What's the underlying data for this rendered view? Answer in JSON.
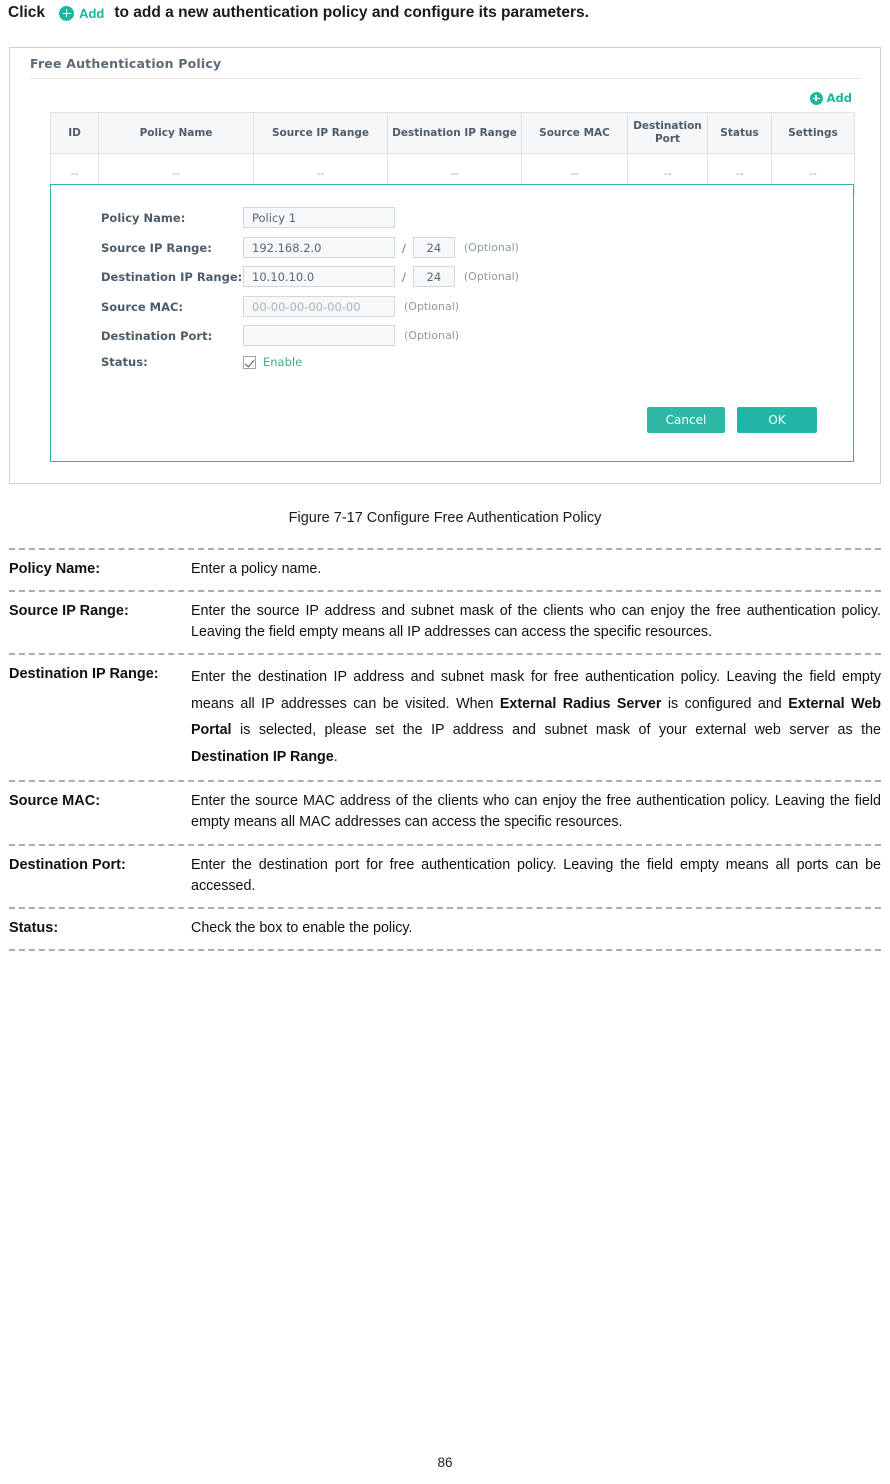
{
  "intro": {
    "click_word": "Click",
    "add_label": "Add",
    "rest": "to add a new authentication policy and configure its parameters."
  },
  "screenshot": {
    "panel_title": "Free Authentication Policy",
    "add_button": "Add",
    "table": {
      "headers": [
        "ID",
        "Policy Name",
        "Source IP Range",
        "Destination IP Range",
        "Source MAC",
        "Destination Port",
        "Status",
        "Settings"
      ],
      "rows": [
        [
          "--",
          "--",
          "--",
          "--",
          "--",
          "--",
          "--",
          "--"
        ]
      ]
    },
    "form": {
      "fields": [
        {
          "label": "Policy Name:",
          "value": "Policy 1",
          "placeholder": "",
          "optional": ""
        },
        {
          "label": "Source IP Range:",
          "value": "192.168.2.0",
          "mask": "24",
          "slash": "/",
          "optional": "(Optional)"
        },
        {
          "label": "Destination IP Range:",
          "value": "10.10.10.0",
          "mask": "24",
          "slash": "/",
          "optional": "(Optional)"
        },
        {
          "label": "Source MAC:",
          "value": "",
          "placeholder": "00-00-00-00-00-00",
          "optional": "(Optional)"
        },
        {
          "label": "Destination Port:",
          "value": "",
          "placeholder": "",
          "optional": "(Optional)"
        },
        {
          "label": "Status:",
          "checkbox_label": "Enable",
          "checked": true
        }
      ],
      "cancel_label": "Cancel",
      "ok_label": "OK"
    }
  },
  "caption": "Figure 7-17 Configure Free Authentication Policy",
  "definitions": [
    {
      "term": "Policy Name:",
      "desc_parts": [
        {
          "text": "Enter a policy name.",
          "bold": false
        }
      ]
    },
    {
      "term": "Source IP Range:",
      "desc_parts": [
        {
          "text": "Enter the source IP address and subnet mask of the clients who can enjoy the free authentication policy. Leaving the field empty means all IP addresses can access the specific resources.",
          "bold": false
        }
      ]
    },
    {
      "term": "Destination IP Range:",
      "desc_parts": [
        {
          "text": "Enter the destination IP address and subnet mask for free authentication policy. Leaving the field empty means all IP addresses can be visited. When ",
          "bold": false
        },
        {
          "text": "External Radius Server",
          "bold": true
        },
        {
          "text": " is configured and ",
          "bold": false
        },
        {
          "text": "External Web Portal",
          "bold": true
        },
        {
          "text": " is selected, please set the IP address and subnet mask of your external web server as the ",
          "bold": false
        },
        {
          "text": "Destination IP Range",
          "bold": true
        },
        {
          "text": ".",
          "bold": false
        }
      ]
    },
    {
      "term": "Source MAC:",
      "desc_parts": [
        {
          "text": "Enter the source MAC address of the clients who can enjoy the free authentication policy. Leaving the field empty means all MAC addresses can access the specific resources.",
          "bold": false
        }
      ]
    },
    {
      "term": "Destination Port:",
      "desc_parts": [
        {
          "text": "Enter the destination port for free authentication policy. Leaving the field empty means all ports can be accessed.",
          "bold": false
        }
      ]
    },
    {
      "term": "Status:",
      "desc_parts": [
        {
          "text": "Check the box to enable the policy.",
          "bold": false
        }
      ]
    }
  ],
  "page_number": "86"
}
